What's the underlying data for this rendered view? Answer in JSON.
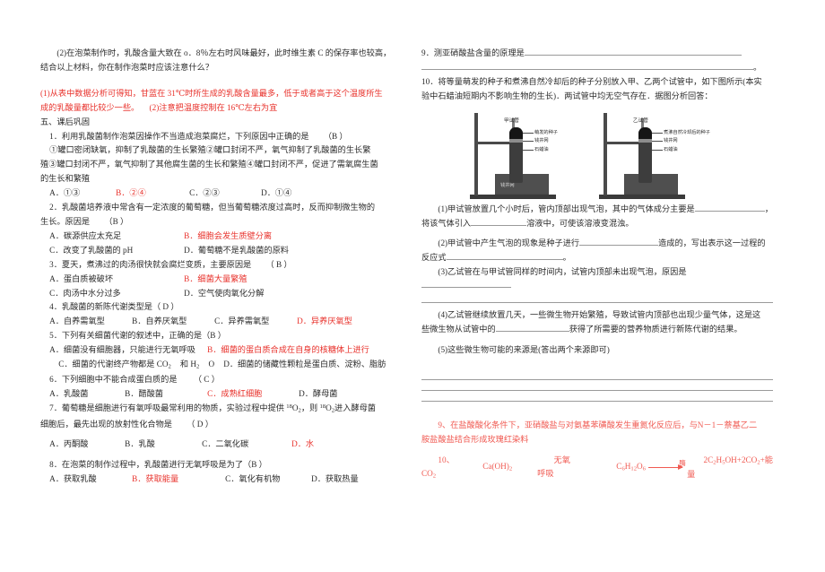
{
  "left_column": {
    "q2_stem_line1": "(2)在泡菜制作时，乳酸含量大致在 o．8％左右时风味最好，此时维生素 C 的保存率也较高，",
    "q2_stem_line2": "结合以上材料，你在制作泡菜时应该注意什么？",
    "answer_red_line1": "(1)从表中数据分析可得知，甘蓝在 31℃时所生成的乳酸含量最多，低于或者高于这个温度所生",
    "answer_red_line2a": "成的乳酸量都比较少一些。",
    "answer_red_line2b": "(2)注意把温度控制在 16℃左右为宜",
    "section_title": "五、课后巩固",
    "q1": {
      "stem": "1．利用乳酸菌制作泡菜因操作不当造成泡菜腐烂，下列原因中正确的是",
      "answer_mark": "（B  ）",
      "detail_line1": "①罐口密闭缺氧，抑制了乳酸菌的生长繁殖②罐口封闭不严，氧气抑制了乳酸菌的生长繁",
      "detail_line2": "殖③罐口封闭不严，氧气抑制了其他腐生菌的生长和繁殖④罐口封闭不严，促进了需氧腐生菌",
      "detail_line3": "的生长和繁殖",
      "options": [
        {
          "label": "A．①③",
          "correct": false
        },
        {
          "label": "B．②④",
          "correct": true
        },
        {
          "label": "C．②③",
          "correct": false
        },
        {
          "label": "D．①④",
          "correct": false
        }
      ]
    },
    "q2": {
      "stem_line1": "2．乳酸菌培养液中常含有一定浓度的葡萄糖，但当葡萄糖浓度过高时，反而抑制微生物的",
      "stem_line2": "生长。原因是",
      "answer_mark": "（B  ）",
      "options": [
        {
          "label": "A．碳源供应太充足",
          "correct": false
        },
        {
          "label": "B．细胞会发生质壁分离",
          "correct": true
        },
        {
          "label": "C．改变了乳酸菌的 pH",
          "correct": false
        },
        {
          "label": "D．葡萄糖不是乳酸菌的原料",
          "correct": false
        }
      ]
    },
    "q3": {
      "stem": "3．夏天，煮沸过的肉汤很快就会腐烂变质，主要原因是",
      "answer_mark": "（ B  ）",
      "options": [
        {
          "label": "A．蛋白质被破坏",
          "correct": false
        },
        {
          "label": "B．细菌大量繁殖",
          "correct": true
        },
        {
          "label": "C．肉汤中水分过多",
          "correct": false
        },
        {
          "label": "D．空气使肉氧化分解",
          "correct": false
        }
      ]
    },
    "q4": {
      "stem": "4．乳酸菌的新陈代谢类型是（ D ）",
      "options": [
        {
          "label": "A．自养需氧型",
          "correct": false
        },
        {
          "label": "B．自养厌氧型",
          "correct": false
        },
        {
          "label": "C．异养需氧型",
          "correct": false
        },
        {
          "label": "D．异养厌氧型",
          "correct": true
        }
      ]
    },
    "q5": {
      "stem": "5．下列有关细菌代谢的叙述中，正确的是（B  ）",
      "opt_a": "A．细菌没有细胞器，只能进行无氧呼吸",
      "opt_b": "B．细菌的蛋白质合成在自身的核糖体上进行",
      "opt_c_pre": "C．细菌的代谢终产物都是 CO",
      "opt_c_sub1": "2",
      "opt_c_mid": " 和 H",
      "opt_c_sub2": "2",
      "opt_c_end": "O",
      "opt_d": "D．细菌的储藏性颗粒是蛋白质、淀粉、脂肪"
    },
    "q6": {
      "stem": "6．下列细胞中不能合成蛋白质的是",
      "answer_mark": "（ C ）",
      "options": [
        {
          "label": "A．乳酸菌",
          "correct": false
        },
        {
          "label": "B．醋酸菌",
          "correct": false
        },
        {
          "label": "C．成熟红细胞",
          "correct": true
        },
        {
          "label": "D．酵母菌",
          "correct": false
        }
      ]
    },
    "q7": {
      "stem_pre": "7．葡萄糖是细胞进行有氧呼吸最常利用的物质，实验过程中提供 ",
      "iso1_sup": "18",
      "iso1_body": "O",
      "iso1_sub": "2",
      "stem_mid": "，则 ",
      "iso2_sup": "18",
      "iso2_body": "O",
      "iso2_sub": "2",
      "stem_end": "进入酵母菌",
      "stem_line2": "细胞后，最先出现的放射性化合物是",
      "answer_mark": "（ D ）",
      "options": [
        {
          "label": "A．丙酮酸",
          "correct": false
        },
        {
          "label": "B．乳酸",
          "correct": false
        },
        {
          "label": "C．二氧化碳",
          "correct": false
        },
        {
          "label": "D．水",
          "correct": true
        }
      ]
    },
    "q8": {
      "stem": "8．在泡菜的制作过程中，乳酸菌进行无氧呼吸是为了（B  ）",
      "options": [
        {
          "label": "A．获取乳酸",
          "correct": false
        },
        {
          "label": "B．获取能量",
          "correct": true
        },
        {
          "label": "C．氧化有机物",
          "correct": false
        },
        {
          "label": "D．获取热量",
          "correct": false
        }
      ]
    }
  },
  "right_column": {
    "q9": {
      "stem": "9．测亚硝酸盐含量的原理是",
      "trailing_period": "。"
    },
    "q10": {
      "stem_line1": "10．将等量萌发的种子和煮沸自然冷却后的种子分别放入甲、乙两个试管中，如下图所示(本实",
      "stem_line2": "验中石蜡油短期内不影响生物的生长)．两试管中均无空气存在．据图分析回答："
    },
    "diagram": {
      "tube_a": {
        "title": "甲试管",
        "labels": [
          "萌发的种子",
          "钱井网",
          "石蜡油"
        ],
        "beaker_label": "钱井网"
      },
      "tube_b": {
        "title": "乙试管",
        "labels": [
          "煮沸自然冷却后的种子",
          "钱井网",
          "石蜡油"
        ]
      }
    },
    "sub1_line1a": "(1)甲试管放置几个小时后，管内顶部出现气泡，其中的气体成分主要是",
    "sub1_line1b": "，",
    "sub1_line2a": "将该气体引入",
    "sub1_line2b": "溶液中，可使该溶液变混浊。",
    "sub2_line1a": "(2)甲试管中产生气泡的现象是种子进行",
    "sub2_line1b": "造成的，写出表示这一过程的",
    "sub2_line2a": "反应式",
    "sub2_line2b": "。",
    "sub3_line1": "(3)乙试管在与甲试管同样的时间内，试管内顶部未出现气泡，原因是",
    "sub4_line1": "(4)乙试管继续放置几天，一些微生物开始繁殖，导致试管内顶部也出现少量气体，这是这",
    "sub4_line2a": "些微生物从试管中的",
    "sub4_line2b": "获得了所需要的营养物质进行新陈代谢的结果。",
    "sub5": "(5)这些微生物可能的来源是(答出两个来源即可)",
    "answer9_line1": "9、在盐酸酸化条件下，亚硝酸盐与对氨基苯磺酸发生重氮化反应后，与N－1－萘基乙二",
    "answer9_line2": "胺盐酸盐结合形成玫瑰红染料",
    "answer10": {
      "prefix": "10、CO",
      "prefix_sub": "2",
      "chem2": "Ca(OH)",
      "chem2_sub": "2",
      "mode": "无氧呼吸",
      "reactant": "C",
      "reactant_sub1": "6",
      "reactant_h": "H",
      "reactant_sub2": "12",
      "reactant_o": "O",
      "reactant_sub3": "6",
      "catalyst": "酶",
      "product1": "2C",
      "product1_sub": "2",
      "product1_h": "H",
      "product1_sub2": "5",
      "product1_oh": "OH+2CO",
      "product1_sub3": "2",
      "product1_tail": "+能量"
    }
  },
  "colors": {
    "text": "#2b2b2b",
    "answer_red": "#e8312b",
    "answer_red_pale": "#f05a52",
    "rule": "#9a9a9a"
  }
}
